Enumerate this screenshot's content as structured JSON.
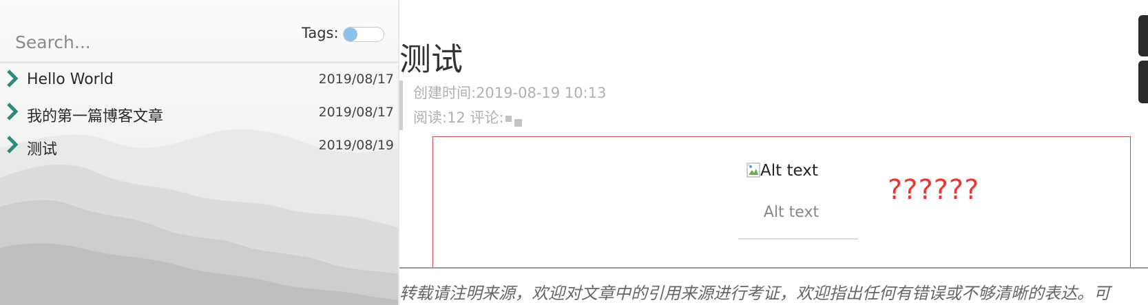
{
  "sidebar": {
    "search": {
      "placeholder": "Search...",
      "value": ""
    },
    "tags": {
      "label": "Tags:",
      "enabled": false
    },
    "posts": [
      {
        "title": "Hello World",
        "date": "2019/08/17"
      },
      {
        "title": "我的第一篇博客文章",
        "date": "2019/08/17"
      },
      {
        "title": "测试",
        "date": "2019/08/19"
      }
    ]
  },
  "article": {
    "title": "测试",
    "created": "创建时间:2019-08-19 10:13",
    "stats": "阅读:12 评论:",
    "image_alt": "Alt text",
    "caption": "Alt text",
    "body_text": "??????",
    "footer_note": "转载请注明来源，欢迎对文章中的引用来源进行考证，欢迎指出任何有错误或不够清晰的表达。可"
  },
  "colors": {
    "accent": "#2e8b7a",
    "question": "#e53935",
    "border": "#c74a4a",
    "toggle_knob": "#8fc0ea"
  },
  "icons": {
    "post_bullet": "chevron-right-icon",
    "image": "broken-image-icon",
    "tags_toggle": "toggle-switch"
  }
}
